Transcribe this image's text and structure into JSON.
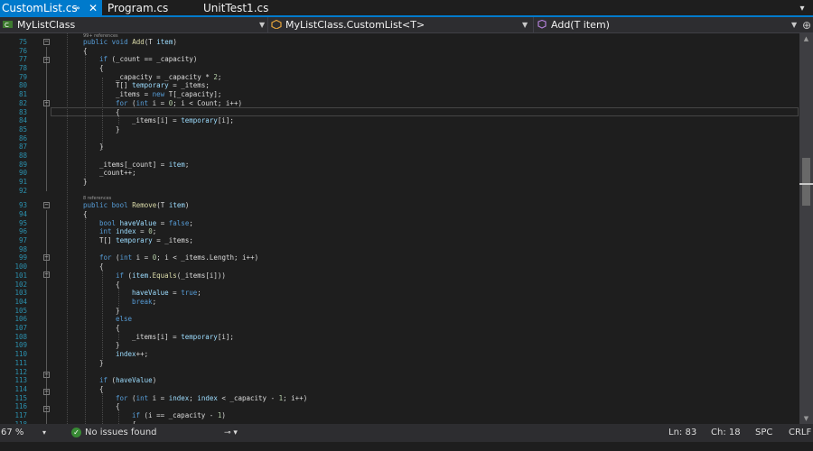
{
  "tabs": [
    {
      "label": "CustomList.cs",
      "active": true
    },
    {
      "label": "Program.cs",
      "active": false
    },
    {
      "label": "UnitTest1.cs",
      "active": false
    }
  ],
  "tab_controls": {
    "pin_glyph": "⊸",
    "close_glyph": "✕",
    "menu_glyph": "▾"
  },
  "navbar": {
    "project": "MyListClass",
    "type": "MyListClass.CustomList<T>",
    "member": "Add(T item)",
    "split_glyph": "⊕"
  },
  "references": [
    {
      "text": "99+ references"
    },
    {
      "text": "8 references"
    }
  ],
  "lines": [
    {
      "num": "75",
      "code": "public void Add(T item)"
    },
    {
      "num": "76",
      "code": "{"
    },
    {
      "num": "77",
      "code": "if (_count == _capacity)"
    },
    {
      "num": "78",
      "code": "{"
    },
    {
      "num": "79",
      "code": "_capacity = _capacity * 2;"
    },
    {
      "num": "80",
      "code": "T[] temporary = _items;"
    },
    {
      "num": "81",
      "code": "_items = new T[_capacity];"
    },
    {
      "num": "82",
      "code": "for (int i = 0; i < Count; i++)"
    },
    {
      "num": "83",
      "code": "{"
    },
    {
      "num": "84",
      "code": "_items[i] = temporary[i];"
    },
    {
      "num": "85",
      "code": "}"
    },
    {
      "num": "86",
      "code": ""
    },
    {
      "num": "87",
      "code": "}"
    },
    {
      "num": "88",
      "code": ""
    },
    {
      "num": "89",
      "code": "_items[_count] = item;"
    },
    {
      "num": "90",
      "code": "_count++;"
    },
    {
      "num": "91",
      "code": "}"
    },
    {
      "num": "92",
      "code": ""
    },
    {
      "num": "93",
      "code": "public bool Remove(T item)"
    },
    {
      "num": "94",
      "code": "{"
    },
    {
      "num": "95",
      "code": "bool haveValue = false;"
    },
    {
      "num": "96",
      "code": "int index = 0;"
    },
    {
      "num": "97",
      "code": "T[] temporary = _items;"
    },
    {
      "num": "98",
      "code": ""
    },
    {
      "num": "99",
      "code": "for (int i = 0; i < _items.Length; i++)"
    },
    {
      "num": "100",
      "code": "{"
    },
    {
      "num": "101",
      "code": "if (item.Equals(_items[i]))"
    },
    {
      "num": "102",
      "code": "{"
    },
    {
      "num": "103",
      "code": "haveValue = true;"
    },
    {
      "num": "104",
      "code": "break;"
    },
    {
      "num": "105",
      "code": "}"
    },
    {
      "num": "106",
      "code": "else"
    },
    {
      "num": "107",
      "code": "{"
    },
    {
      "num": "108",
      "code": "_items[i] = temporary[i];"
    },
    {
      "num": "109",
      "code": "}"
    },
    {
      "num": "110",
      "code": "index++;"
    },
    {
      "num": "111",
      "code": "}"
    },
    {
      "num": "112",
      "code": ""
    },
    {
      "num": "113",
      "code": "if (haveValue)"
    },
    {
      "num": "114",
      "code": "{"
    },
    {
      "num": "115",
      "code": "for (int i = index; index < _capacity - 1; i++)"
    },
    {
      "num": "116",
      "code": "{"
    },
    {
      "num": "117",
      "code": "if (i == _capacity - 1)"
    },
    {
      "num": "118",
      "code": "{"
    }
  ],
  "scrollbar": {
    "up_glyph": "▲",
    "down_glyph": "▼"
  },
  "status": {
    "zoom": "67 %",
    "zoom_arrow": "▾",
    "issues": "No issues found",
    "check_glyph": "✓",
    "quick_actions": "⊸ ▾",
    "line": "Ln: 83",
    "col": "Ch: 18",
    "spaces": "SPC",
    "eol": "CRLF"
  },
  "colors": {
    "accent": "#007acc",
    "editor_bg": "#1e1e1e",
    "keyword": "#569cd6",
    "line_number": "#2b91af",
    "method": "#dcdcaa",
    "parameter": "#9cdcfe",
    "success": "#388a34"
  }
}
